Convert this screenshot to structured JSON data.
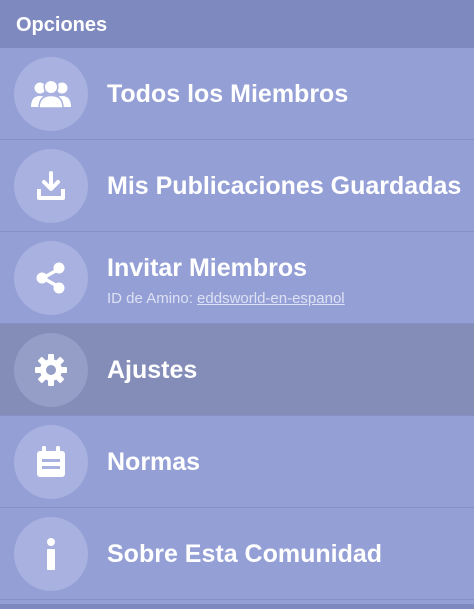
{
  "header": {
    "title": "Opciones"
  },
  "menu": {
    "items": [
      {
        "label": "Todos los Miembros",
        "icon": "members-icon"
      },
      {
        "label": "Mis Publicaciones Guardadas",
        "icon": "download-icon"
      },
      {
        "label": "Invitar Miembros",
        "icon": "share-icon",
        "sub_prefix": "ID de Amino: ",
        "sub_link": "eddsworld-en-espanol"
      },
      {
        "label": "Ajustes",
        "icon": "gear-icon",
        "selected": true
      },
      {
        "label": "Normas",
        "icon": "calendar-icon"
      },
      {
        "label": "Sobre Esta Comunidad",
        "icon": "info-icon"
      }
    ]
  },
  "colors": {
    "background": "#949fd6",
    "header": "#7e89bf",
    "icon_circle": "#a8b1e0",
    "selected_row": "#838db8",
    "text": "#ffffff"
  }
}
